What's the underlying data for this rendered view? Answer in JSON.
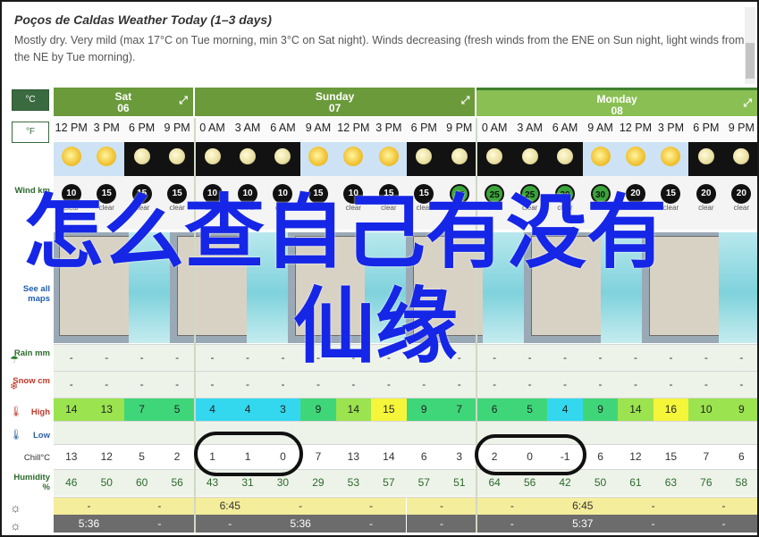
{
  "header": {
    "title": "Poços de Caldas Weather Today (1–3 days)",
    "description": "Mostly dry. Very mild (max 17°C on Tue morning, min 3°C on Sat night). Winds decreasing (fresh winds from the ENE on Sun night, light winds from the NE by Tue morning)."
  },
  "units": {
    "celsius": "°C",
    "fahrenheit": "°F"
  },
  "row_labels": {
    "wind": "Wind km",
    "see_all_maps": "See all maps",
    "rain": "Rain mm",
    "snow": "Snow cm",
    "high": "High",
    "low": "Low",
    "chill": "Chill°C",
    "humidity": "Humidity %"
  },
  "days": [
    {
      "name": "Sat",
      "date": "06"
    },
    {
      "name": "Sunday",
      "date": "07"
    },
    {
      "name": "Monday",
      "date": "08"
    }
  ],
  "times": [
    "12 PM",
    "3 PM",
    "6 PM",
    "9 PM",
    "0 AM",
    "3 AM",
    "6 AM",
    "9 AM",
    "12 PM",
    "3 PM",
    "6 PM",
    "9 PM",
    "0 AM",
    "3 AM",
    "6 AM",
    "9 AM",
    "12 PM",
    "3 PM",
    "6 PM",
    "9 PM"
  ],
  "sky": [
    "day",
    "day",
    "night",
    "night",
    "night",
    "night",
    "night",
    "day",
    "day",
    "day",
    "night",
    "night",
    "night",
    "night",
    "night",
    "day",
    "day",
    "day",
    "night",
    "night"
  ],
  "wind": [
    "10",
    "15",
    "15",
    "15",
    "10",
    "10",
    "10",
    "15",
    "10",
    "15",
    "15",
    "25",
    "25",
    "25",
    "30",
    "30",
    "20",
    "15",
    "20",
    "20"
  ],
  "wind_desc": [
    "clear",
    "clear",
    "clear",
    "clear",
    "clear",
    "clear",
    "clear",
    "clear",
    "clear",
    "clear",
    "clear",
    "clear",
    "clear",
    "clear",
    "clear",
    "clear",
    "clear",
    "clear",
    "clear",
    "clear"
  ],
  "rain": [
    "-",
    "-",
    "-",
    "-",
    "-",
    "-",
    "-",
    "-",
    "-",
    "-",
    "-",
    "-",
    "-",
    "-",
    "-",
    "-",
    "-",
    "-",
    "-",
    "-"
  ],
  "snow": [
    "-",
    "-",
    "-",
    "-",
    "-",
    "-",
    "-",
    "-",
    "-",
    "-",
    "-",
    "-",
    "-",
    "-",
    "-",
    "-",
    "-",
    "-",
    "-",
    "-"
  ],
  "high": [
    "14",
    "13",
    "7",
    "5",
    "4",
    "4",
    "3",
    "9",
    "14",
    "15",
    "9",
    "7",
    "6",
    "5",
    "4",
    "9",
    "14",
    "16",
    "10",
    "9"
  ],
  "high_colors": [
    "#9be34f",
    "#9be34f",
    "#3fd67a",
    "#3fd67a",
    "#33d8ef",
    "#33d8ef",
    "#33d8ef",
    "#3fd67a",
    "#9be34f",
    "#f5f53a",
    "#3fd67a",
    "#3fd67a",
    "#3fd67a",
    "#3fd67a",
    "#33d8ef",
    "#3fd67a",
    "#9be34f",
    "#f5f53a",
    "#9be34f",
    "#9be34f"
  ],
  "low": [
    "",
    "",
    "",
    "",
    "",
    "",
    "",
    "",
    "",
    "",
    "",
    "",
    "",
    "",
    "",
    "",
    "",
    "",
    "",
    ""
  ],
  "chill": [
    "13",
    "12",
    "5",
    "2",
    "1",
    "1",
    "0",
    "7",
    "13",
    "14",
    "6",
    "3",
    "2",
    "0",
    "-1",
    "6",
    "12",
    "15",
    "7",
    "6"
  ],
  "humidity": [
    "46",
    "50",
    "60",
    "56",
    "43",
    "31",
    "30",
    "29",
    "53",
    "57",
    "57",
    "51",
    "64",
    "56",
    "42",
    "50",
    "61",
    "63",
    "76",
    "58"
  ],
  "sunrise": [
    "-",
    "-",
    "6:45",
    "-",
    "-",
    "-",
    "-",
    "6:45",
    "-",
    "-"
  ],
  "sunset": [
    "5:36",
    "-",
    "-",
    "5:36",
    "-",
    "-",
    "-",
    "5:37",
    "-",
    "-"
  ],
  "overlay": {
    "line1": "怎么查自己有没有",
    "line2": "仙缘",
    "color": "#1526e6"
  }
}
